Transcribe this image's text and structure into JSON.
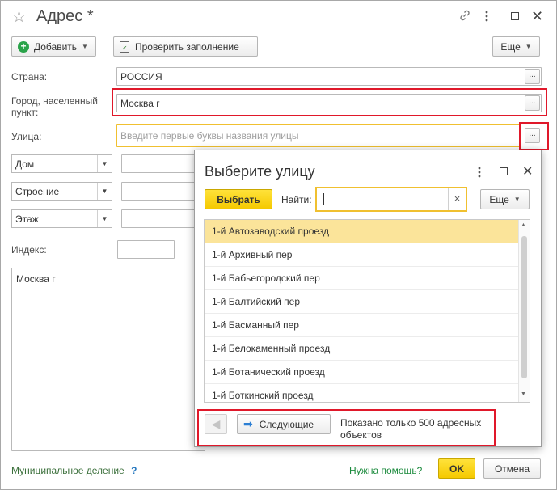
{
  "window": {
    "title": "Адрес *",
    "icons": [
      "star-icon",
      "link-icon",
      "more-icon",
      "minimize-icon",
      "maximize-icon",
      "close-icon"
    ]
  },
  "toolbar": {
    "add_label": "Добавить",
    "check_label": "Проверить заполнение",
    "more_label": "Еще"
  },
  "form": {
    "country_label": "Страна:",
    "country_value": "РОССИЯ",
    "city_label": "Город, населенный пункт:",
    "city_value": "Москва г",
    "street_label": "Улица:",
    "street_placeholder": "Введите первые буквы названия улицы",
    "dots": "...",
    "selects": [
      {
        "value": "Дом"
      },
      {
        "value": "Строение"
      },
      {
        "value": "Этаж"
      }
    ],
    "index_label": "Индекс:",
    "presentation": "Москва г"
  },
  "footer": {
    "municipal_label": "Муниципальное деление",
    "help_q": "?",
    "help_link": "Нужна помощь?",
    "ok_label": "OK",
    "cancel_label": "Отмена"
  },
  "dialog": {
    "title": "Выберите улицу",
    "select_label": "Выбрать",
    "find_label": "Найти:",
    "find_value": "",
    "clear": "×",
    "more_label": "Еще",
    "streets": [
      "1-й Автозаводский проезд",
      "1-й Архивный пер",
      "1-й Бабьегородский пер",
      "1-й Балтийский пер",
      "1-й Басманный пер",
      "1-й Белокаменный проезд",
      "1-й Ботанический проезд",
      "1-й Боткинский проезд"
    ],
    "next_label": "Следующие",
    "info_text": "Показано только 500 адресных объектов"
  },
  "colors": {
    "accent_red": "#e0182a",
    "select_yellow": "#fbe49a",
    "button_yellow": "#f5c900",
    "link_green": "#1a8a3c"
  }
}
